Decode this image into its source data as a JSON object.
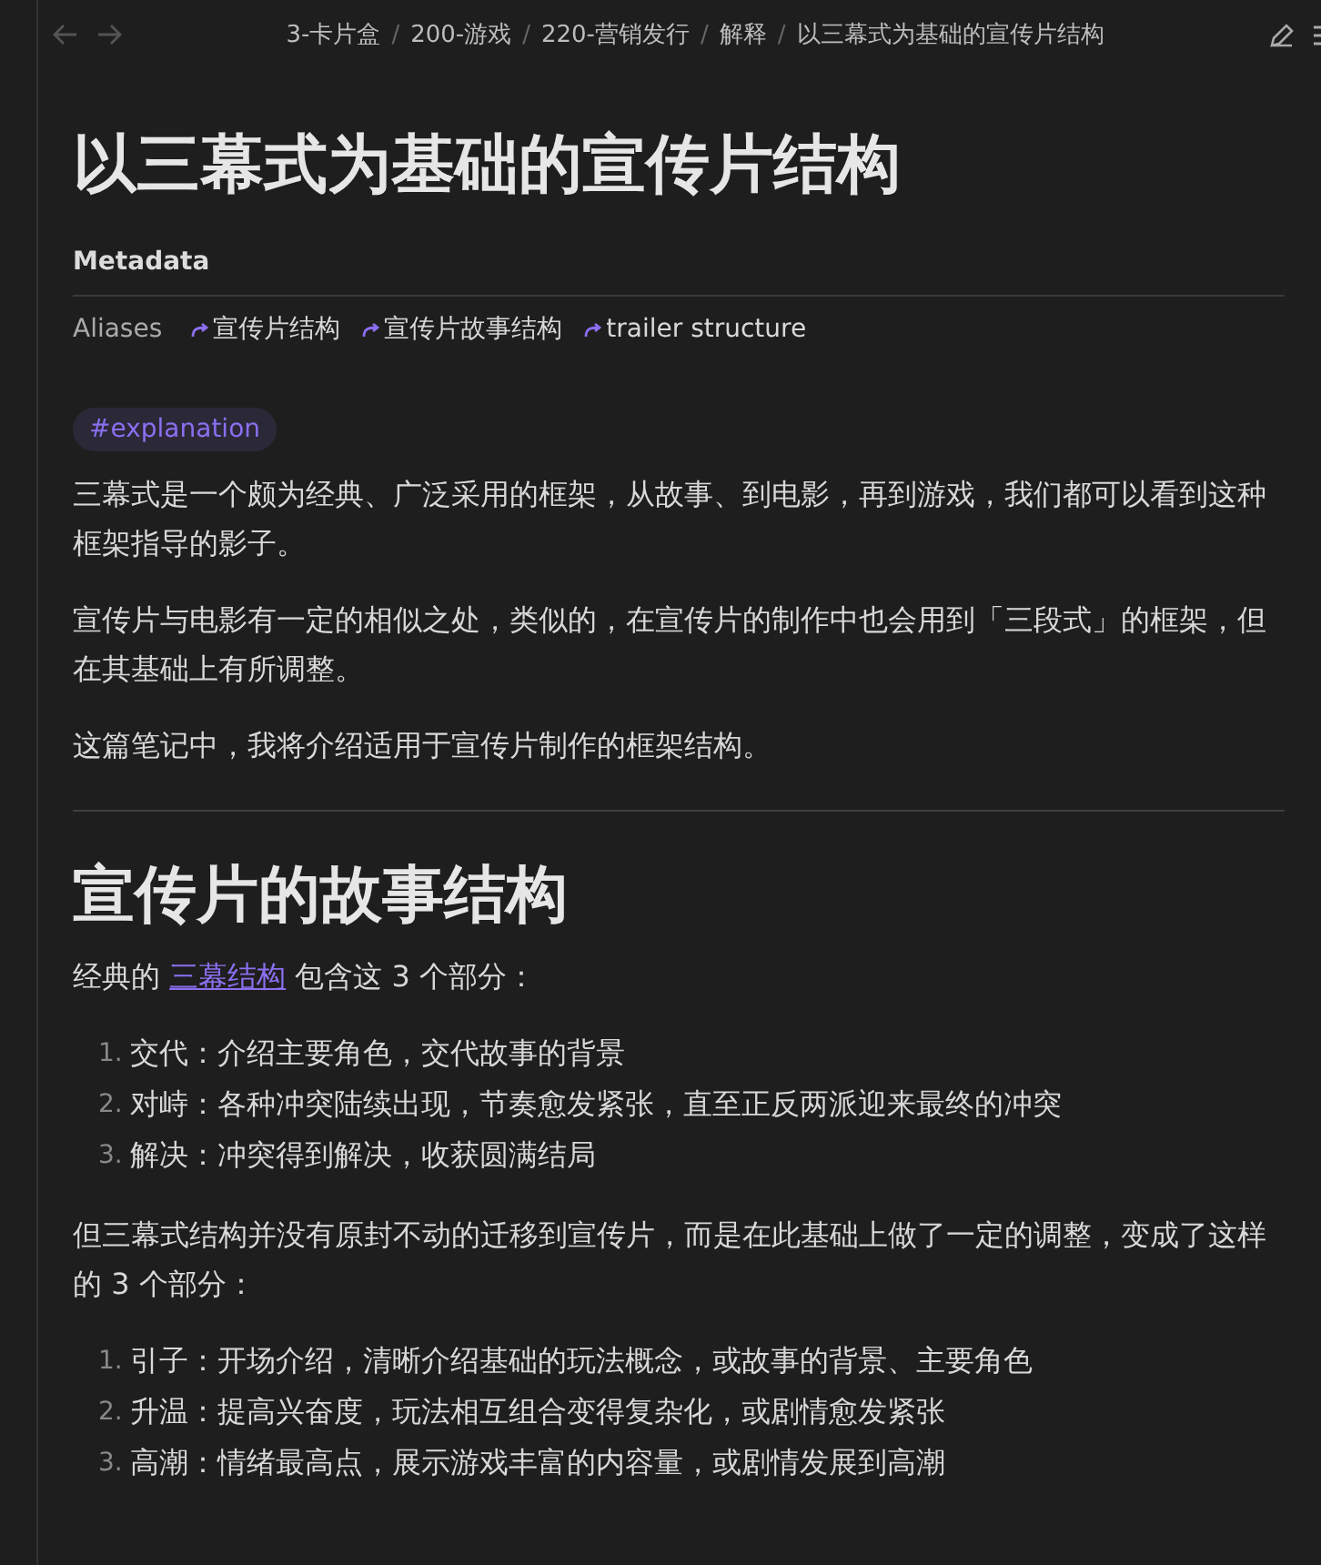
{
  "breadcrumbs": [
    "3-卡片盒",
    "200-游戏",
    "220-营销发行",
    "解释",
    "以三幕式为基础的宣传片结构"
  ],
  "breadcrumb_separator": "/",
  "title": "以三幕式为基础的宣传片结构",
  "metadata": {
    "heading": "Metadata",
    "aliases_label": "Aliases",
    "aliases": [
      "宣传片结构",
      "宣传片故事结构",
      "trailer structure"
    ]
  },
  "tag": "#explanation",
  "intro": [
    "三幕式是一个颇为经典、广泛采用的框架，从故事、到电影，再到游戏，我们都可以看到这种框架指导的影子。",
    "宣传片与电影有一定的相似之处，类似的，在宣传片的制作中也会用到「三段式」的框架，但在其基础上有所调整。",
    "这篇笔记中，我将介绍适用于宣传片制作的框架结构。"
  ],
  "section": {
    "heading": "宣传片的故事结构",
    "lead": {
      "before": "经典的",
      "link": "三幕结构",
      "after": "包含这 3 个部分："
    },
    "list1": [
      {
        "number": "1.",
        "text": "交代：介绍主要角色，交代故事的背景"
      },
      {
        "number": "2.",
        "text": "对峙：各种冲突陆续出现，节奏愈发紧张，直至正反两派迎来最终的冲突"
      },
      {
        "number": "3.",
        "text": "解决：冲突得到解决，收获圆满结局"
      }
    ],
    "middle": "但三幕式结构并没有原封不动的迁移到宣传片，而是在此基础上做了一定的调整，变成了这样的 3 个部分：",
    "list2": [
      {
        "number": "1.",
        "text": "引子：开场介绍，清晰介绍基础的玩法概念，或故事的背景、主要角色"
      },
      {
        "number": "2.",
        "text": "升温：提高兴奋度，玩法相互组合变得复杂化，或剧情愈发紧张"
      },
      {
        "number": "3.",
        "text": "高潮：情绪最高点，展示游戏丰富的内容量，或剧情发展到高潮"
      }
    ]
  }
}
